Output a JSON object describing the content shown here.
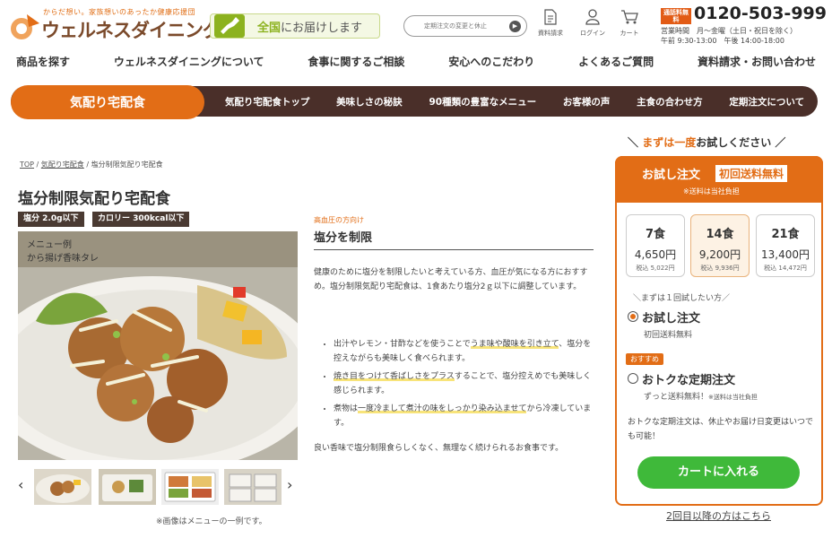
{
  "header": {
    "tagline": "からだ想い。家族想いのあったか健康応援団",
    "logo_text": "ウェルネスダイニング",
    "delivery_bold": "全国",
    "delivery_rest": "にお届けします",
    "search_placeholder": "定期注文の変更と休止",
    "icons": [
      {
        "name": "document-icon",
        "label": "資料請求"
      },
      {
        "name": "user-icon",
        "label": "ログイン"
      },
      {
        "name": "cart-icon",
        "label": "カート"
      }
    ],
    "free_badge": "通話料無料",
    "tel": "0120-503-999",
    "hours_line1": "営業時間　月〜金曜（土日・祝日を除く）",
    "hours_line2": "午前 9:30-13:00　午後 14:00-18:00"
  },
  "global_nav": [
    "商品を探す",
    "ウェルネスダイニングについて",
    "食事に関するご相談",
    "安心へのこだわり",
    "よくあるご質問",
    "資料請求・お問い合わせ"
  ],
  "sub_nav": {
    "active": "気配り宅配食",
    "items": [
      "気配り宅配食トップ",
      "美味しさの秘訣",
      "90種類の豊富なメニュー",
      "お客様の声",
      "主食の合わせ方",
      "定期注文について"
    ]
  },
  "breadcrumb": [
    "TOP",
    "気配り宅配食",
    "塩分制限気配り宅配食"
  ],
  "product": {
    "title": "塩分制限気配り宅配食",
    "tags": [
      "塩分 2.0g以下",
      "カロリー 300kcal以下"
    ],
    "image_label_1": "メニュー例",
    "image_label_2": "から揚げ香味タレ",
    "caption": "※画像はメニューの一例です。"
  },
  "description": {
    "pre": "高血圧の方向け",
    "heading": "塩分を制限",
    "para": "健康のために塩分を制限したいと考えている方、血圧が気になる方におすすめ。塩分制限気配り宅配食は、1食あたり塩分2ｇ以下に調整しています。",
    "bullets": [
      {
        "a": "出汁やレモン・甘酢などを使うことで",
        "h": "うま味や酸味を引き立て",
        "b": "、塩分を控えながらも美味しく食べられます。"
      },
      {
        "a": "",
        "h": "焼き目をつけて香ばしさをプラス",
        "b": "することで、塩分控えめでも美味しく感じられます。"
      },
      {
        "a": "煮物は",
        "h": "一度冷まして煮汁の味をしっかり染み込ませて",
        "b": "から冷凍しています。"
      }
    ],
    "closing": "良い香味で塩分制限食らしくなく、無理なく続けられるお食事です。"
  },
  "order": {
    "headline_pre": "＼ ",
    "headline_bold": "まずは一度",
    "headline_rest": "お試しください ／",
    "title": "お試し注文",
    "free": "初回送料無料",
    "note": "※送料は当社負担",
    "plans": [
      {
        "n": "7食",
        "p": "4,650円",
        "t": "税込 5,022円"
      },
      {
        "n": "14食",
        "p": "9,200円",
        "t": "税込 9,936円"
      },
      {
        "n": "21食",
        "p": "13,400円",
        "t": "税込 14,472円"
      }
    ],
    "once_label": "＼まずは１回試したい方／",
    "opt1": "お試し注文",
    "opt1_sub": "初回送料無料",
    "recommend": "おすすめ",
    "opt2": "おトクな定期注文",
    "opt2_sub": "ずっと送料無料！",
    "opt2_note": "※送料は当社負担",
    "info": "おトクな定期注文は、休止やお届け日変更はいつでも可能！",
    "cart_button": "カートに入れる",
    "second_link": "2回目以降の方はこちら"
  },
  "colors": {
    "accent": "#e26d16",
    "dark": "#4a2f29",
    "green": "#3fb93a"
  }
}
